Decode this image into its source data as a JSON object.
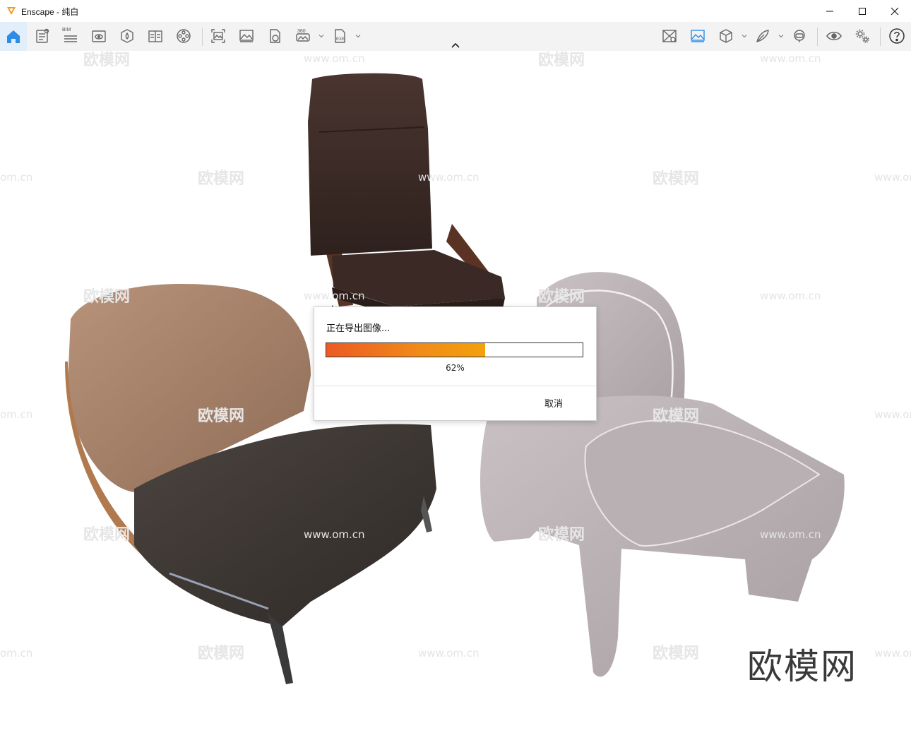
{
  "window": {
    "app_name": "Enscape",
    "separator": " - ",
    "document": "纯白",
    "logo_color": "#f29a1a"
  },
  "toolbar": {
    "accent": "#2d8ce6",
    "bim_label": "BIM",
    "pano_label": "360",
    "exe_label": "EXE",
    "left_icons": [
      "home-icon",
      "file-settings-icon",
      "bim-info-icon",
      "view-management-icon",
      "asset-library-icon",
      "material-editor-icon",
      "video-editor-icon",
      "batch-render-icon",
      "screenshot-icon",
      "render-panorama-icon",
      "export-web-icon",
      "exe-export-icon"
    ],
    "right_icons": [
      "sync-views-icon",
      "capture-image-icon",
      "cube-view-icon",
      "feather-icon",
      "vr-headset-icon",
      "visibility-eye-icon",
      "settings-gears-icon",
      "help-icon"
    ]
  },
  "viewport": {
    "watermark_cn": "欧模网",
    "watermark_url": "www.om.cn",
    "watermark_partial": "om.cn",
    "brand_watermark": "欧模网"
  },
  "dialog": {
    "title": "正在导出图像...",
    "progress": 0.62,
    "progress_text": "62%",
    "cancel_label": "取消"
  }
}
